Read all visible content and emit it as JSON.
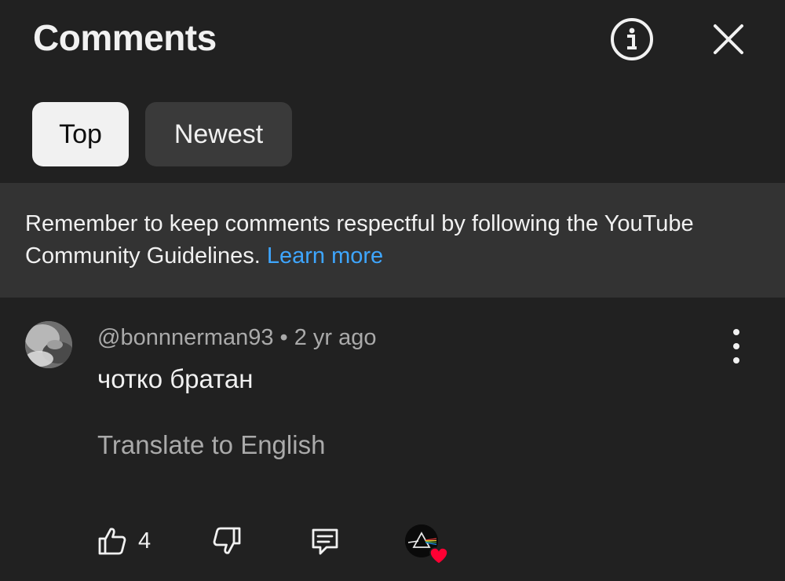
{
  "header": {
    "title": "Comments",
    "info_icon": "info-circle-icon",
    "close_icon": "close-icon"
  },
  "sort_chips": [
    {
      "label": "Top",
      "selected": true
    },
    {
      "label": "Newest",
      "selected": false
    }
  ],
  "notice": {
    "text": "Remember to keep comments respectful by following the YouTube Community Guidelines. ",
    "link_text": "Learn more",
    "link_color": "#3ea6ff"
  },
  "comments": [
    {
      "author": "@bonnnerman93",
      "separator": "•",
      "time": "2 yr ago",
      "text": "чотко братан",
      "translate_label": "Translate to English",
      "likes": "4",
      "creator_hearted": true
    }
  ],
  "colors": {
    "background": "#212121",
    "banner": "#333333",
    "chip_selected": "#f1f1f1",
    "chip_unselected": "#3a3a3a",
    "secondary_text": "#aaaaaa",
    "heart": "#ff0033"
  }
}
